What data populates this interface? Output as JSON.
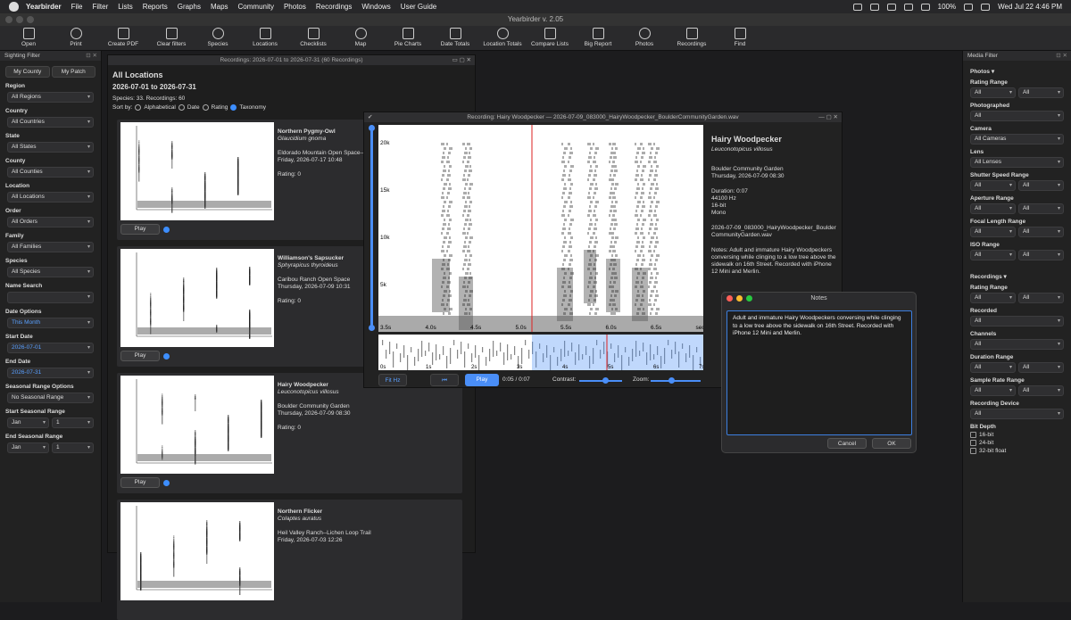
{
  "menubar": {
    "app": "Yearbirder",
    "items": [
      "File",
      "Filter",
      "Lists",
      "Reports",
      "Graphs",
      "Maps",
      "Community",
      "Photos",
      "Recordings",
      "Windows",
      "User Guide"
    ],
    "battery": "100%",
    "datetime": "Wed Jul 22  4:46 PM"
  },
  "window_title": "Yearbirder v. 2.05",
  "toolbar": [
    {
      "label": "Open",
      "icon": "folder-icon"
    },
    {
      "label": "Print",
      "icon": "printer-icon"
    },
    {
      "label": "Create PDF",
      "icon": "pdf-icon"
    },
    {
      "label": "Clear filters",
      "icon": "filter-icon"
    },
    {
      "label": "Species",
      "icon": "bird-icon"
    },
    {
      "label": "Locations",
      "icon": "pin-icon"
    },
    {
      "label": "Checklists",
      "icon": "checklist-icon"
    },
    {
      "label": "Map",
      "icon": "globe-icon"
    },
    {
      "label": "Pie Charts",
      "icon": "pie-icon"
    },
    {
      "label": "Date Totals",
      "icon": "calendar-sum-icon"
    },
    {
      "label": "Location Totals",
      "icon": "location-sum-icon"
    },
    {
      "label": "Compare Lists",
      "icon": "compare-icon"
    },
    {
      "label": "Big Report",
      "icon": "report-icon"
    },
    {
      "label": "Photos",
      "icon": "camera-icon"
    },
    {
      "label": "Recordings",
      "icon": "microphone-icon"
    },
    {
      "label": "Find",
      "icon": "search-icon"
    }
  ],
  "sighting_filter": {
    "title": "Sighting Filter",
    "tabs": [
      "My County",
      "My Patch"
    ],
    "fields": [
      {
        "label": "Region",
        "value": "All Regions"
      },
      {
        "label": "Country",
        "value": "All Countries"
      },
      {
        "label": "State",
        "value": "All States"
      },
      {
        "label": "County",
        "value": "All Counties"
      },
      {
        "label": "Location",
        "value": "All Locations"
      },
      {
        "label": "Order",
        "value": "All Orders"
      },
      {
        "label": "Family",
        "value": "All Families"
      },
      {
        "label": "Species",
        "value": "All Species"
      }
    ],
    "name_search_label": "Name Search",
    "date_options_label": "Date Options",
    "date_options_value": "This Month",
    "start_date_label": "Start Date",
    "start_date": "2026-07-01",
    "end_date_label": "End Date",
    "end_date": "2026-07-31",
    "seasonal_label": "Seasonal Range Options",
    "seasonal_value": "No Seasonal Range",
    "start_seasonal_label": "Start Seasonal Range",
    "start_seasonal": [
      "Jan",
      "1"
    ],
    "end_seasonal_label": "End Seasonal Range",
    "end_seasonal": [
      "Jan",
      "1"
    ]
  },
  "recordings_panel": {
    "header": "Recordings: 2026-07-01 to 2026-07-31 (60 Recordings)",
    "title": "All Locations",
    "range": "2026-07-01 to 2026-07-31",
    "counts": "Species: 33.  Recordings: 60",
    "sort_label": "Sort by:",
    "sort_options": [
      "Alphabetical",
      "Date",
      "Rating",
      "Taxonomy"
    ],
    "sort_selected": "Taxonomy",
    "play_label": "Play",
    "cards": [
      {
        "name": "Northern Pygmy-Owl",
        "sci": "Glaucidium gnoma",
        "place": "Eldorado Mountain Open Space--Fo",
        "date": "Friday, 2026-07-17 10:48",
        "rating": "Rating: 0"
      },
      {
        "name": "Williamson's Sapsucker",
        "sci": "Sphyrapicus thyroideus",
        "place": "Caribou Ranch Open Space",
        "date": "Thursday, 2026-07-09 10:31",
        "rating": "Rating: 0"
      },
      {
        "name": "Hairy Woodpecker",
        "sci": "Leuconotopicus villosus",
        "place": "Boulder Community Garden",
        "date": "Thursday, 2026-07-09 08:30",
        "rating": "Rating: 0"
      },
      {
        "name": "Northern Flicker",
        "sci": "Colaptes auratus",
        "place": "Heil Valley Ranch--Lichen Loop Trail",
        "date": "Friday, 2026-07-03 12:26",
        "rating": ""
      }
    ]
  },
  "recording_window": {
    "title": "Recording: Hairy Woodpecker — 2026-07-09_083000_HairyWoodpecker_BoulderCommunityGarden.wav",
    "name": "Hairy Woodpecker",
    "sci": "Leuconotopicus villosus",
    "place": "Boulder Community Garden",
    "date": "Thursday, 2026-07-09 08:30",
    "duration": "Duration: 0:07",
    "rate": "44100 Hz",
    "bits": "16-bit",
    "channels": "Mono",
    "file": "2026-07-09_083000_HairyWoodpecker_BoulderCommunityGarden.wav",
    "notes": "Notes: Adult and immature Hairy Woodpeckers conversing while clinging to a low tree above the sidewalk on 16th Street. Recorded with iPhone 12 Mini and Merlin.",
    "freq_ticks": [
      "20k",
      "15k",
      "10k",
      "5k"
    ],
    "time_ticks": [
      "3.5s",
      "4.0s",
      "4.5s",
      "5.0s",
      "5.5s",
      "6.0s",
      "6.5s",
      "sec"
    ],
    "ov_ticks": [
      "0s",
      "1s",
      "2s",
      "3s",
      "4s",
      "5s",
      "6s",
      "7s"
    ],
    "fit_label": "Fit Hz",
    "play_label": "Play",
    "time": "0:05 / 0:07",
    "contrast_label": "Contrast:",
    "zoom_label": "Zoom:"
  },
  "notes_dialog": {
    "title": "Notes",
    "text": "Adult and immature Hairy Woodpeckers conversing while clinging to a low tree above the sidewalk on 16th Street. Recorded with iPhone 12 Mini and Merlin.",
    "cancel": "Cancel",
    "ok": "OK"
  },
  "media_filter": {
    "title": "Media Filter",
    "photos_label": "Photos ▾",
    "rating_range": "Rating Range",
    "all": "All",
    "photographed": "Photographed",
    "camera": "Camera",
    "camera_value": "All Cameras",
    "lens": "Lens",
    "lens_value": "All Lenses",
    "shutter": "Shutter Speed Range",
    "aperture": "Aperture Range",
    "focal": "Focal Length Range",
    "iso": "ISO Range",
    "recordings_label": "Recordings ▾",
    "rec_rating": "Rating Range",
    "recorded": "Recorded",
    "channels": "Channels",
    "duration": "Duration Range",
    "sample_rate": "Sample Rate Range",
    "device": "Recording Device",
    "bit_depth": "Bit Depth",
    "bit_options": [
      "16-bit",
      "24-bit",
      "32-bit float"
    ]
  }
}
